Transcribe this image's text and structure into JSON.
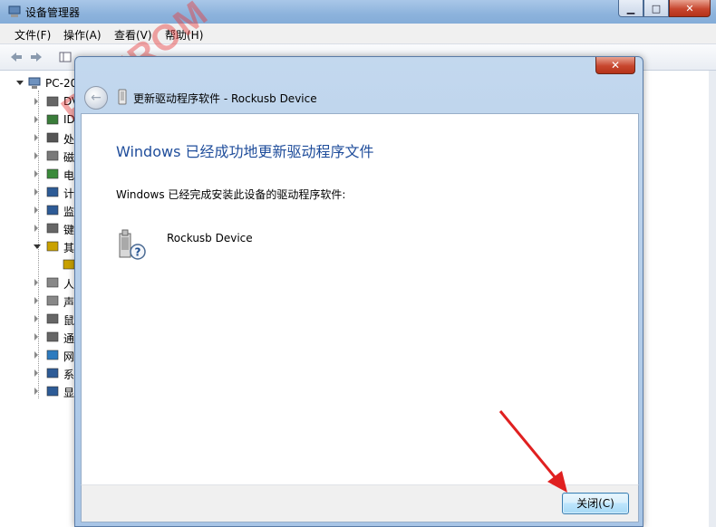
{
  "main_window": {
    "title": "设备管理器",
    "menu": [
      "文件(F)",
      "操作(A)",
      "查看(V)",
      "帮助(H)"
    ],
    "tree": {
      "root_label": "PC-20",
      "categories": [
        {
          "label": "DV",
          "icon": "dvd-drive-icon"
        },
        {
          "label": "ID",
          "icon": "ide-controller-icon"
        },
        {
          "label": "处",
          "icon": "processor-icon"
        },
        {
          "label": "磁",
          "icon": "disk-drive-icon"
        },
        {
          "label": "电",
          "icon": "battery-icon"
        },
        {
          "label": "计",
          "icon": "computer-icon"
        },
        {
          "label": "监",
          "icon": "monitor-icon"
        },
        {
          "label": "键",
          "icon": "keyboard-icon"
        },
        {
          "label": "其",
          "icon": "other-devices-icon"
        },
        {
          "label": "",
          "icon": "unknown-device-warning-icon"
        },
        {
          "label": "人",
          "icon": "hid-icon"
        },
        {
          "label": "声",
          "icon": "speaker-icon"
        },
        {
          "label": "鼠",
          "icon": "mouse-icon"
        },
        {
          "label": "通",
          "icon": "usb-controller-icon"
        },
        {
          "label": "网",
          "icon": "network-adapter-icon"
        },
        {
          "label": "系",
          "icon": "system-devices-icon"
        },
        {
          "label": "显",
          "icon": "display-adapter-icon"
        }
      ]
    }
  },
  "watermark": "ROXROM",
  "dialog": {
    "header_title": "更新驱动程序软件 - Rockusb Device",
    "heading": "Windows 已经成功地更新驱动程序文件",
    "subtext": "Windows 已经完成安装此设备的驱动程序软件:",
    "device_name": "Rockusb Device",
    "close_button": "关闭(C)"
  },
  "colors": {
    "heading_blue": "#1f4d9b",
    "arrow_red": "#e02020"
  }
}
